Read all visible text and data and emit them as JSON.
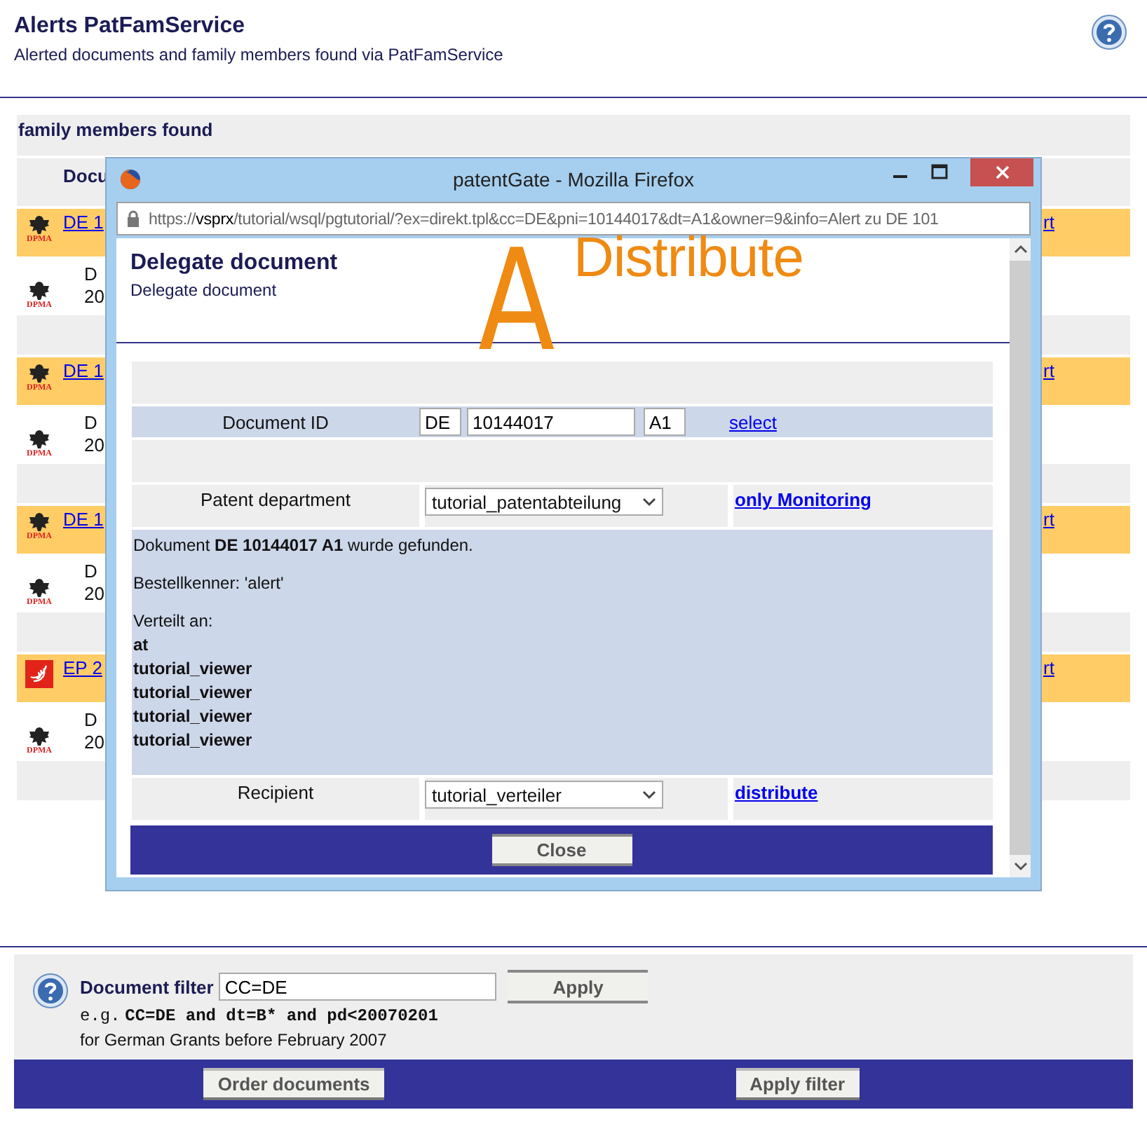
{
  "header": {
    "title": "Alerts PatFamService",
    "subtitle": "Alerted documents and family members found via PatFamService"
  },
  "section_title": "family members found",
  "table": {
    "column_2": "Docu",
    "groups": [
      {
        "alert": {
          "logo": {
            "kind": "dpma",
            "label": "DPMA"
          },
          "link": "DE 1",
          "column_3": "rt"
        },
        "family": {
          "logo": {
            "kind": "dpma",
            "label": "DPMA"
          },
          "line_1": "D",
          "line_2": "20"
        }
      },
      {
        "alert": {
          "logo": {
            "kind": "dpma",
            "label": "DPMA"
          },
          "link": "DE 1",
          "column_3": "rt"
        },
        "family": {
          "logo": {
            "kind": "dpma",
            "label": "DPMA"
          },
          "line_1": "D",
          "line_2": "20"
        }
      },
      {
        "alert": {
          "logo": {
            "kind": "dpma",
            "label": "DPMA"
          },
          "link": "DE 1",
          "column_3": "rt"
        },
        "family": {
          "logo": {
            "kind": "dpma",
            "label": "DPMA"
          },
          "line_1": "D",
          "line_2": "20"
        }
      },
      {
        "alert": {
          "logo": {
            "kind": "epo"
          },
          "link": "EP 2",
          "column_3": "rt"
        },
        "family": {
          "logo": {
            "kind": "dpma",
            "label": "DPMA"
          },
          "line_1": "D",
          "line_2": "20"
        }
      }
    ]
  },
  "popup": {
    "window_title": "patentGate - Mozilla Firefox",
    "url": "https://**vsprx**/tutorial/wsql/pgtutorial/?ex=direkt.tpl&cc=DE&pni=10144017&dt=A1&owner=9&info=Alert zu DE 101",
    "heading": "Delegate document",
    "subheading": "Delegate document",
    "logo_letter": "A",
    "logo_word": "Distribute",
    "document_id": {
      "label": "Document ID",
      "country": "DE",
      "number": "10144017",
      "kind": "A1",
      "link": "select"
    },
    "department": {
      "label": "Patent department",
      "value": "tutorial_patentabteilung",
      "link": "only Monitoring"
    },
    "message": {
      "found": "Dokument **DE 10144017 A1** wurde gefunden.",
      "order": "Bestellkenner: 'alert'",
      "distributed_label": "Verteilt an:",
      "recipients": [
        "at",
        "tutorial_viewer",
        "tutorial_viewer",
        "tutorial_viewer",
        "tutorial_viewer"
      ]
    },
    "recipient": {
      "label": "Recipient",
      "value": "tutorial_verteiler",
      "link": "distribute"
    },
    "close_button": "Close"
  },
  "filter": {
    "label": "Document filter",
    "value": "CC=DE",
    "apply_button": "Apply",
    "example_prefix": "e.g.",
    "example": "CC=DE and dt=B* and pd<20070201",
    "note": "for German Grants before February 2007"
  },
  "buttons": [
    "Order documents",
    "Apply filter"
  ]
}
